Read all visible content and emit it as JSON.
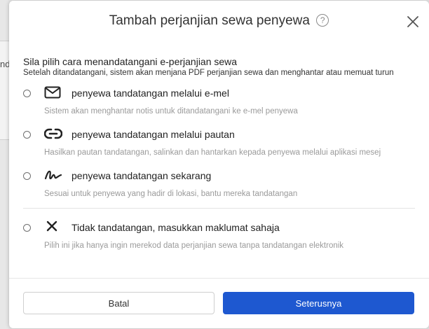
{
  "background": {
    "partial_text": "nd"
  },
  "dialog": {
    "title": "Tambah perjanjian sewa penyewa",
    "help_symbol": "?",
    "close_icon": "close-icon",
    "section_title": "Sila pilih cara menandatangani e-perjanjian sewa",
    "section_subtitle": "Setelah ditandatangani, sistem akan menjana PDF perjanjian sewa dan menghantar atau memuat turun",
    "options": [
      {
        "icon": "envelope-icon",
        "label": "penyewa tandatangan melalui e-mel",
        "description": "Sistem akan menghantar notis untuk ditandatangani ke e-mel penyewa"
      },
      {
        "icon": "link-icon",
        "label": "penyewa tandatangan melalui pautan",
        "description": "Hasilkan pautan tandatangan, salinkan dan hantarkan kepada penyewa melalui aplikasi mesej"
      },
      {
        "icon": "signature-icon",
        "label": "penyewa tandatangan sekarang",
        "description": "Sesuai untuk penyewa yang hadir di lokasi, bantu mereka tandatangan"
      },
      {
        "icon": "x-icon",
        "label": "Tidak tandatangan, masukkan maklumat sahaja",
        "description": "Pilih ini jika hanya ingin merekod data perjanjian sewa tanpa tandatangan elektronik"
      }
    ],
    "buttons": {
      "cancel": "Batal",
      "next": "Seterusnya"
    }
  },
  "colors": {
    "primary": "#1e58d0",
    "muted_text": "#9a9a9a"
  }
}
